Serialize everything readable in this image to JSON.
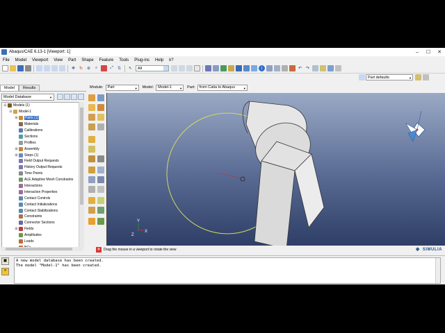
{
  "window": {
    "title": "Abaqus/CAE 6.13-1 [Viewport: 1]"
  },
  "menu": [
    "File",
    "Model",
    "Viewport",
    "View",
    "Part",
    "Shape",
    "Feature",
    "Tools",
    "Plug-ins",
    "Help"
  ],
  "help_icon": "k?",
  "toolbar": {
    "selection_filter": "All"
  },
  "part_defaults": "Part defaults",
  "tree_tabs": [
    "Model",
    "Results"
  ],
  "model_database": "Model Database",
  "context": {
    "module_label": "Module:",
    "module_value": "Part",
    "model_label": "Model:",
    "model_value": "Model-1",
    "part_label": "Part:",
    "part_value": "from Catia to Abaqus"
  },
  "tree": [
    {
      "label": "Models (1)",
      "level": 0,
      "expand": "⊟",
      "color": "#7a5a2a",
      "selected": false
    },
    {
      "label": "Model-1",
      "level": 1,
      "expand": "⊟",
      "color": "#c9a64a",
      "selected": false
    },
    {
      "label": "Parts (1)",
      "level": 2,
      "expand": "⊞",
      "color": "#d08a2a",
      "selected": true
    },
    {
      "label": "Materials",
      "level": 2,
      "expand": "",
      "color": "#8a6a4a",
      "selected": false
    },
    {
      "label": "Calibrations",
      "level": 2,
      "expand": "",
      "color": "#5a7ab0",
      "selected": false
    },
    {
      "label": "Sections",
      "level": 2,
      "expand": "",
      "color": "#4aa0a0",
      "selected": false
    },
    {
      "label": "Profiles",
      "level": 2,
      "expand": "",
      "color": "#9a9a9a",
      "selected": false
    },
    {
      "label": "Assembly",
      "level": 2,
      "expand": "⊞",
      "color": "#c08a3a",
      "selected": false
    },
    {
      "label": "Steps (1)",
      "level": 2,
      "expand": "⊞",
      "color": "#6a8ac0",
      "selected": false
    },
    {
      "label": "Field Output Requests",
      "level": 2,
      "expand": "",
      "color": "#7a7ab0",
      "selected": false
    },
    {
      "label": "History Output Requests",
      "level": 2,
      "expand": "",
      "color": "#7a7ab0",
      "selected": false
    },
    {
      "label": "Time Points",
      "level": 2,
      "expand": "",
      "color": "#8a8a8a",
      "selected": false
    },
    {
      "label": "ALE Adaptive Mesh Constraints",
      "level": 2,
      "expand": "",
      "color": "#6a9a6a",
      "selected": false
    },
    {
      "label": "Interactions",
      "level": 2,
      "expand": "",
      "color": "#a06a9a",
      "selected": false
    },
    {
      "label": "Interaction Properties",
      "level": 2,
      "expand": "",
      "color": "#a06a9a",
      "selected": false
    },
    {
      "label": "Contact Controls",
      "level": 2,
      "expand": "",
      "color": "#5a8ab0",
      "selected": false
    },
    {
      "label": "Contact Initializations",
      "level": 2,
      "expand": "",
      "color": "#5a8ab0",
      "selected": false
    },
    {
      "label": "Contact Stabilizations",
      "level": 2,
      "expand": "",
      "color": "#5a8ab0",
      "selected": false
    },
    {
      "label": "Constraints",
      "level": 2,
      "expand": "",
      "color": "#b0704a",
      "selected": false
    },
    {
      "label": "Connector Sections",
      "level": 2,
      "expand": "",
      "color": "#6a6aa0",
      "selected": false
    },
    {
      "label": "Fields",
      "level": 2,
      "expand": "⊞",
      "color": "#c03a3a",
      "selected": false
    },
    {
      "label": "Amplitudes",
      "level": 2,
      "expand": "",
      "color": "#6a9a4a",
      "selected": false
    },
    {
      "label": "Loads",
      "level": 2,
      "expand": "",
      "color": "#c06a3a",
      "selected": false
    },
    {
      "label": "BCs",
      "level": 2,
      "expand": "",
      "color": "#c06a3a",
      "selected": false
    }
  ],
  "prompt": {
    "text": "Drag the mouse in a viewport to rotate the view"
  },
  "brand": "SIMULIA",
  "messages": [
    "A new model database has been created.",
    "The model \"Model-1\" has been created."
  ],
  "triad": {
    "x": "X",
    "y": "Y",
    "z": "Z"
  },
  "colors": {
    "viewport_top": "#9aa9c5",
    "viewport_bottom": "#2e3e66",
    "selection": "#3b73c8",
    "rotate_circle": "#d8d85a"
  }
}
